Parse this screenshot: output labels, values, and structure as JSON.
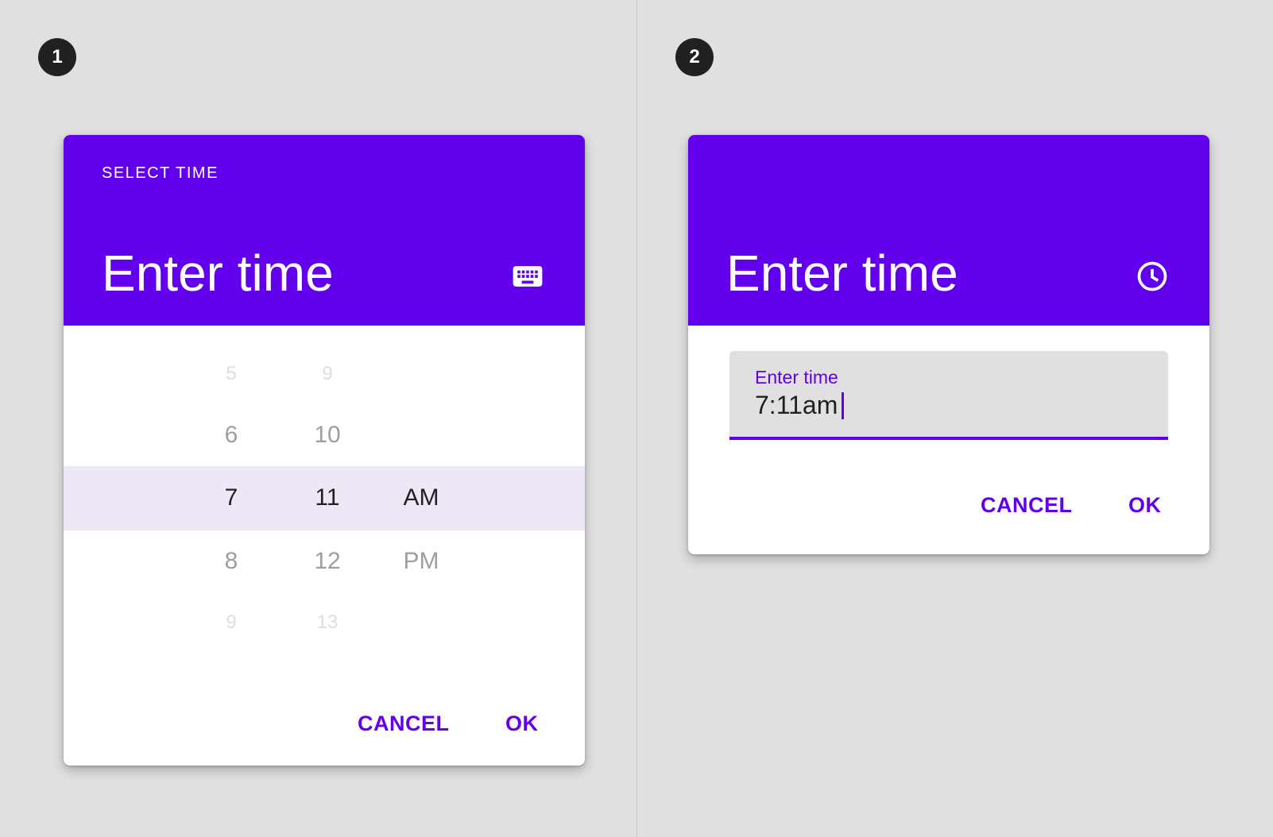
{
  "badges": [
    "1",
    "2"
  ],
  "dialog1": {
    "overline": "SELECT TIME",
    "title": "Enter time",
    "mode_icon": "keyboard-icon",
    "hours": [
      "5",
      "6",
      "7",
      "8",
      "9"
    ],
    "minutes": [
      "9",
      "10",
      "11",
      "12",
      "13"
    ],
    "periods": [
      "AM",
      "PM"
    ],
    "selected": {
      "hour": "7",
      "minute": "11",
      "period": "AM"
    },
    "cancel_label": "CANCEL",
    "ok_label": "OK"
  },
  "dialog2": {
    "title": "Enter time",
    "mode_icon": "clock-icon",
    "field_label": "Enter time",
    "field_value": "7:11am",
    "cancel_label": "CANCEL",
    "ok_label": "OK"
  },
  "colors": {
    "accent": "#6200ee",
    "selection": "#ede7f6",
    "background": "#e0e0e0"
  }
}
